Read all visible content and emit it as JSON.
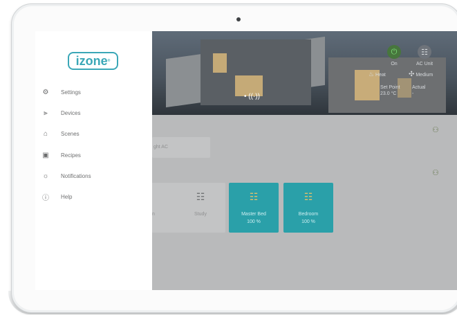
{
  "sidebar": {
    "logo_text": "izone",
    "logo_mark": "®",
    "items": [
      {
        "label": "Settings",
        "icon": "gear-icon",
        "glyph": "⚙"
      },
      {
        "label": "Devices",
        "icon": "devices-icon",
        "glyph": "⫸"
      },
      {
        "label": "Scenes",
        "icon": "scenes-icon",
        "glyph": "⌂"
      },
      {
        "label": "Recipes",
        "icon": "recipes-icon",
        "glyph": "▣"
      },
      {
        "label": "Notifications",
        "icon": "bulb-icon",
        "glyph": "☼"
      },
      {
        "label": "Help",
        "icon": "info-icon",
        "glyph": "ⓘ"
      }
    ]
  },
  "hero": {
    "dots": "• ((·))"
  },
  "controls": {
    "power_label": "On",
    "ac_label": "AC Unit",
    "mode_label": "Heat",
    "fan_label": "Medium",
    "setpoint_label": "Set Point",
    "setpoint_value": "23.0 °C",
    "actual_label": "Actual",
    "actual_value": "-"
  },
  "content": {
    "partial_text": "ght AC",
    "tiles": [
      {
        "name": "n",
        "value": ""
      },
      {
        "name": "Study",
        "value": ""
      },
      {
        "name": "Master Bed",
        "value": "100 %"
      },
      {
        "name": "Bedroom",
        "value": "100 %"
      }
    ]
  },
  "colors": {
    "accent": "#3aa7b7",
    "power_green": "#4caf50",
    "tile_active": "#2aa0a9",
    "tile_idle": "#c3c4c5"
  }
}
